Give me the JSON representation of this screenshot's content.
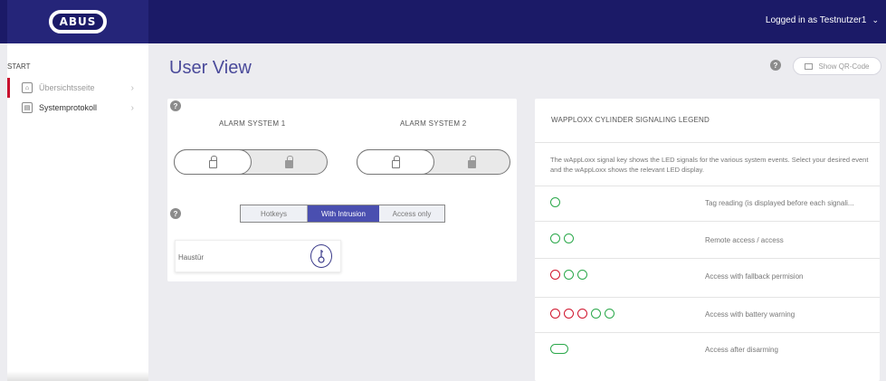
{
  "header": {
    "logo_text": "ABUS",
    "user_label": "Logged in as Testnutzer1",
    "user_chevron": "⌄"
  },
  "sidebar": {
    "section": "START",
    "items": [
      {
        "label": "Übersichtsseite",
        "icon": "home-icon"
      },
      {
        "label": "Systemprotokoll",
        "icon": "calendar-icon"
      }
    ]
  },
  "page": {
    "title": "User View",
    "help": "?",
    "qr_button": "Show QR-Code"
  },
  "alarm_systems": {
    "system1": "ALARM SYSTEM 1",
    "system2": "ALARM SYSTEM 2"
  },
  "mode_tabs": [
    "Hotkeys",
    "With Intrusion",
    "Access only"
  ],
  "active_tab": "With Intrusion",
  "door": {
    "name": "Haustür"
  },
  "legend": {
    "title": "WAPPLOXX CYLINDER SIGNALING LEGEND",
    "description": "The wAppLoxx signal key shows the LED signals for the various system events. Select your desired event and the wAppLoxx shows the relevant LED display.",
    "rows": [
      {
        "label": "Tag reading (is displayed before each signali...",
        "pattern": [
          "g"
        ]
      },
      {
        "label": "Remote access / access",
        "pattern": [
          "g",
          "g"
        ]
      },
      {
        "label": "Access with fallback permision",
        "pattern": [
          "r",
          "g",
          "g"
        ]
      },
      {
        "label": "Access with battery warning",
        "pattern": [
          "r",
          "r",
          "r",
          "g",
          "g"
        ]
      },
      {
        "label": "Access after disarming",
        "pattern": [
          "pill"
        ]
      }
    ]
  },
  "colors": {
    "brand": "#1b1a67",
    "accent": "#4a4fb0",
    "green": "#2aa84a",
    "red": "#d0142c",
    "active_marker": "#c8102e"
  }
}
